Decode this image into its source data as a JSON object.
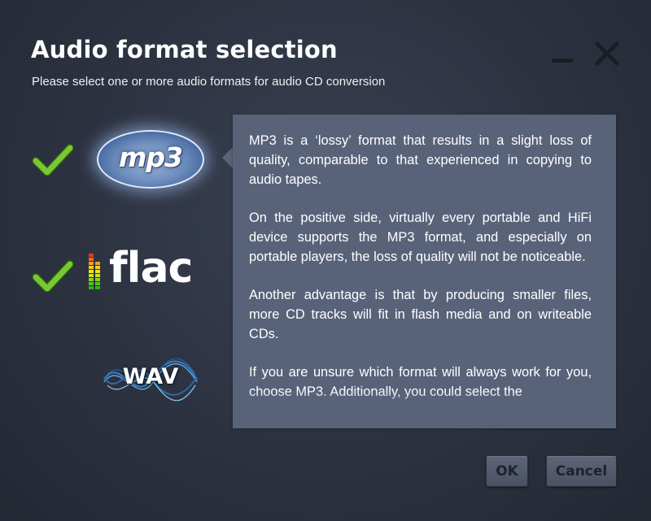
{
  "dialog": {
    "title": "Audio format selection",
    "subtitle": "Please select one or more audio formats for audio CD conversion"
  },
  "window_controls": {
    "minimize_icon": "minimize-icon",
    "close_icon": "close-icon"
  },
  "formats": [
    {
      "id": "mp3",
      "logo_text": "mp3",
      "selected": true
    },
    {
      "id": "flac",
      "logo_text": "flac",
      "selected": true
    },
    {
      "id": "wav",
      "logo_text": "WAV",
      "selected": false
    }
  ],
  "description": {
    "paragraphs": [
      "MP3 is a ‘lossy’ format that results in a slight loss of quality, comparable to that experienced in copying to audio tapes.",
      "On the positive side, virtually every portable and HiFi device supports the MP3 format, and especially on portable players, the loss of quality will not be noticeable.",
      "Another advantage is that by producing smaller files, more CD tracks will fit in flash media and on writeable CDs.",
      "If you are unsure which format will always work for you, choose MP3. Additionally, you could select the"
    ]
  },
  "buttons": {
    "ok_label": "OK",
    "cancel_label": "Cancel"
  },
  "colors": {
    "background": "#2c3240",
    "panel": "#58637a",
    "check_green": "#6fbf2a",
    "button": "#4f5668"
  }
}
